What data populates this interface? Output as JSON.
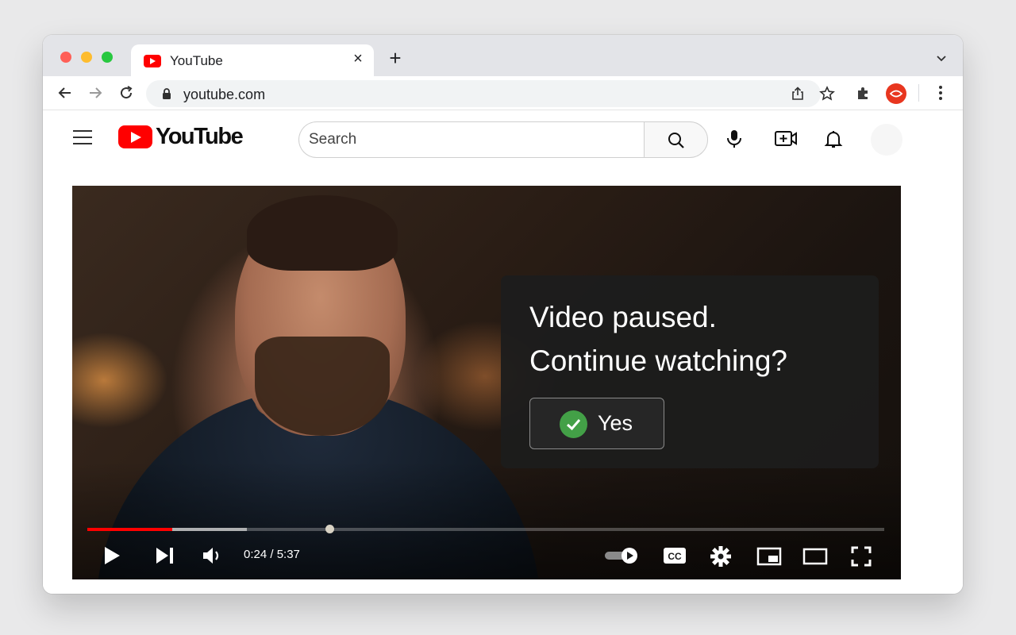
{
  "browser": {
    "tab_title": "YouTube",
    "tab_close": "×",
    "new_tab": "+",
    "url": "youtube.com"
  },
  "youtube": {
    "logo_text": "YouTube",
    "search_placeholder": "Search"
  },
  "player": {
    "dialog_line1": "Video paused.",
    "dialog_line2": "Continue watching?",
    "yes_label": "Yes",
    "time": "0:24 / 5:37",
    "progress_played": 0.107,
    "progress_buffered": 0.2,
    "autoplay_on": true
  },
  "colors": {
    "youtube_red": "#ff0000",
    "check_green": "#43a047",
    "extension_red": "#e8361f"
  }
}
